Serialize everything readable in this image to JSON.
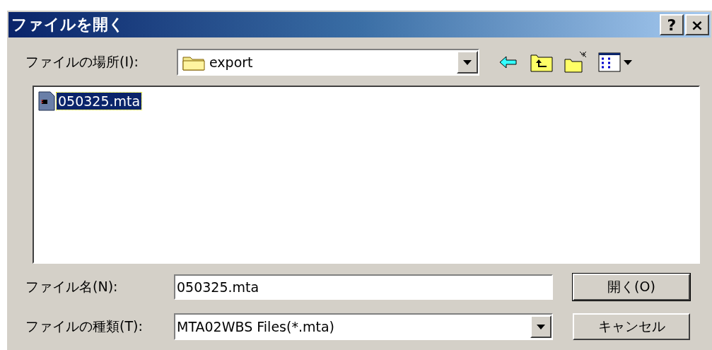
{
  "window": {
    "title": "ファイルを開く",
    "title_buttons": [
      "?",
      "×"
    ]
  },
  "location": {
    "label": "ファイルの場所(I):",
    "value": "export"
  },
  "files": [
    {
      "name": "050325.mta",
      "selected": true
    }
  ],
  "file_name": {
    "label": "ファイル名(N):",
    "value": "050325.mta"
  },
  "file_type": {
    "label": "ファイルの種類(T):",
    "value": "MTA02WBS Files(*.mta)"
  },
  "buttons": [
    {
      "label": "開く(O)",
      "default": true
    },
    {
      "label": "キャンセル",
      "default": false
    }
  ]
}
